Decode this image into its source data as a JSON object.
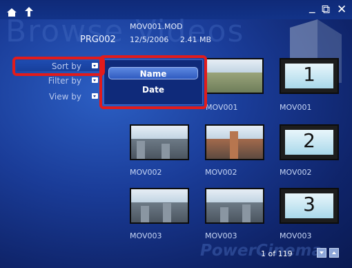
{
  "window": {
    "watermark_title": "Browse Videos",
    "watermark_footer": "PowerCinema"
  },
  "controls": {
    "minimize": "_",
    "restore": "⧉",
    "close": "✕"
  },
  "info": {
    "folder": "PRG002",
    "filename": "MOV001.MOD",
    "date": "12/5/2006",
    "size": "2.41 MB"
  },
  "sidebar": {
    "items": [
      {
        "label": "Sort by"
      },
      {
        "label": "Filter by"
      },
      {
        "label": "View by"
      }
    ]
  },
  "sort_menu": {
    "options": [
      {
        "label": "Name",
        "selected": true
      },
      {
        "label": "Date",
        "selected": false
      }
    ]
  },
  "grid": {
    "items": [
      {
        "caption": "MOV001",
        "kind": "photo"
      },
      {
        "caption": "MOV001",
        "kind": "number",
        "number": "1"
      },
      {
        "caption": "MOV002",
        "kind": "photo"
      },
      {
        "caption": "MOV002",
        "kind": "photo"
      },
      {
        "caption": "MOV002",
        "kind": "number",
        "number": "2"
      },
      {
        "caption": "MOV003",
        "kind": "photo"
      },
      {
        "caption": "MOV003",
        "kind": "photo"
      },
      {
        "caption": "MOV003",
        "kind": "number",
        "number": "3"
      }
    ]
  },
  "pager": {
    "text": "1 of 119"
  },
  "colors": {
    "highlight": "#e21b1b",
    "background": "#1a3c98"
  }
}
